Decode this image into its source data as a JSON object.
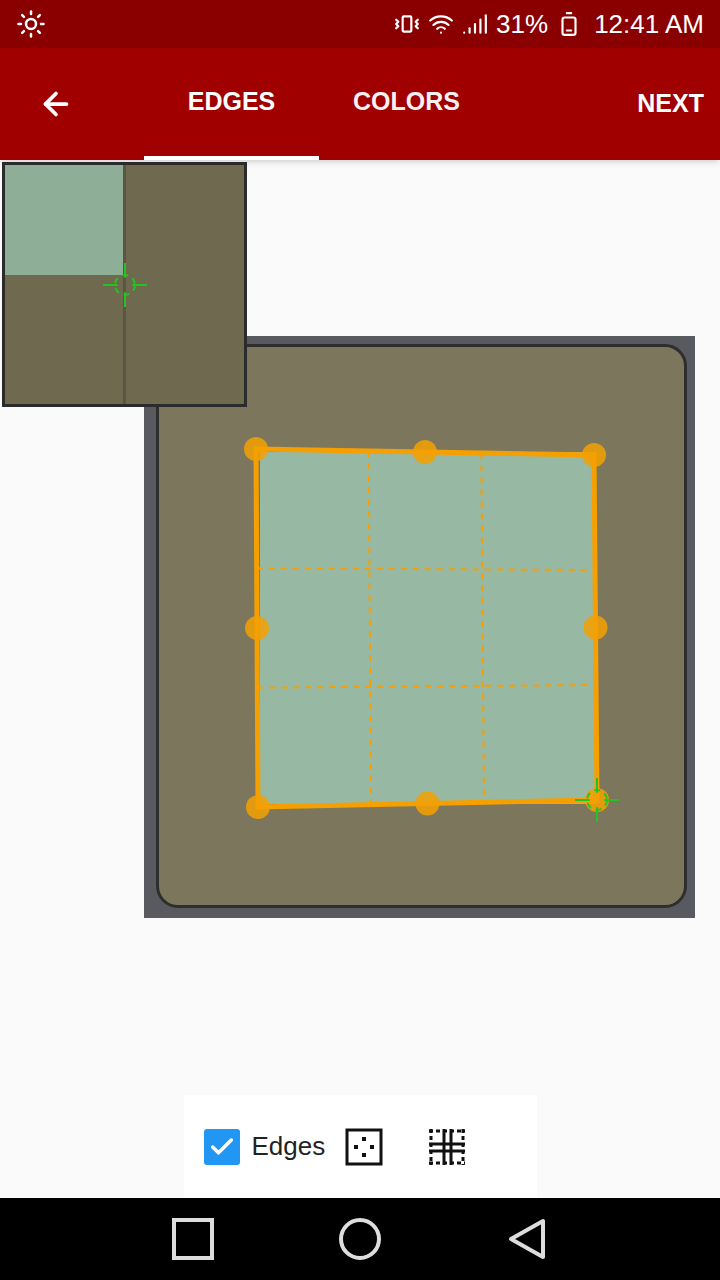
{
  "status_bar": {
    "battery": "31%",
    "time": "12:41 AM"
  },
  "tabs": [
    {
      "label": "EDGES",
      "selected": true
    },
    {
      "label": "COLORS",
      "selected": false
    }
  ],
  "next_button": "NEXT",
  "toolbar": {
    "edges": {
      "label": "Edges",
      "checked": true
    }
  }
}
